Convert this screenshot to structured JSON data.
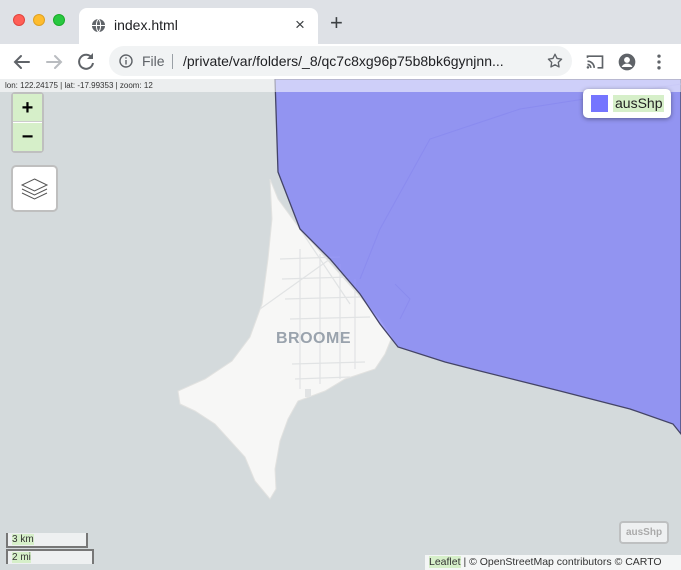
{
  "browser": {
    "tab_title": "index.html",
    "tab_close": "×",
    "new_tab": "+",
    "scheme_label": "File",
    "url": "/private/var/folders/_8/qc7c8xg96p75b8bk6gynjnn...",
    "icons": {
      "globe": "globe-icon",
      "back": "arrow-left-icon",
      "forward": "arrow-right-icon",
      "reload": "reload-icon",
      "info": "info-icon",
      "star": "star-icon",
      "cast": "cast-icon",
      "account": "account-icon",
      "menu": "kebab-menu-icon"
    }
  },
  "map": {
    "coords_readout": "lon: 122.24175 | lat: -17.99353 | zoom: 12",
    "zoom_in_label": "+",
    "zoom_out_label": "−",
    "place_label": "BROOME",
    "legend": {
      "label": "ausShp",
      "color": "#6666ff"
    },
    "ghost_button_label": "ausShp",
    "scale_km": "3 km",
    "scale_mi": "2 mi",
    "attribution_leaflet": "Leaflet",
    "attribution_rest": " | © OpenStreetMap contributors © CARTO",
    "colors": {
      "water": "#d4dadc",
      "land": "#f7f7f6",
      "polygon_fill": "#6666ff",
      "polygon_stroke": "#444466",
      "highlight": "#d6efc9"
    }
  }
}
